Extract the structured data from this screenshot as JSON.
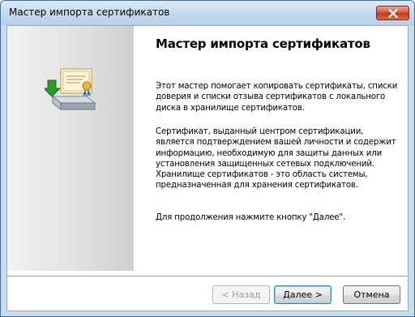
{
  "window": {
    "title": "Мастер импорта сертификатов"
  },
  "main": {
    "heading": "Мастер импорта сертификатов",
    "paragraphs": [
      "Этот мастер помогает копировать сертификаты, списки доверия и списки отзыва сертификатов с локального диска в хранилище сертификатов.",
      "Сертификат, выданный центром сертификации, является подтверждением вашей личности и содержит информацию, необходимую для защиты данных или установления защищенных сетевых подключений. Хранилище сертификатов - это область системы, предназначенная для хранения сертификатов.",
      "Для продолжения нажмите кнопку \"Далее\"."
    ]
  },
  "buttons": {
    "back": "< Назад",
    "next": "Далее >",
    "cancel": "Отмена"
  },
  "icons": {
    "side": "certificate-import-icon",
    "close": "close-icon"
  },
  "colors": {
    "close": "#c23a1f",
    "accent": "#3c7fb1",
    "arrow": "#2e9a2e"
  }
}
